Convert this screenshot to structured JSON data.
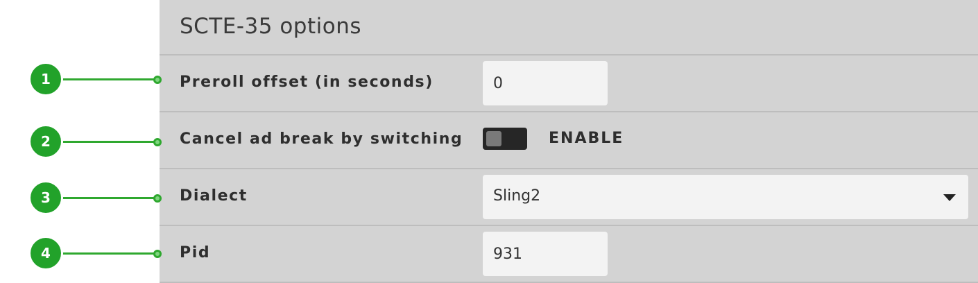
{
  "panel": {
    "title": "SCTE-35 options"
  },
  "rows": {
    "preroll": {
      "label": "Preroll offset (in seconds)",
      "value": "0"
    },
    "cancel_ad_break": {
      "label": "Cancel ad break by switching",
      "toggle_label": "ENABLE",
      "enabled": false
    },
    "dialect": {
      "label": "Dialect",
      "selected": "Sling2"
    },
    "pid": {
      "label": "Pid",
      "value": "931"
    }
  },
  "callouts": [
    "1",
    "2",
    "3",
    "4"
  ],
  "colors": {
    "callout_green": "#22a22a",
    "panel_bg": "#d3d3d3",
    "input_bg": "#f3f3f3",
    "toggle_bg": "#262626"
  },
  "icons": {
    "dropdown": "chevron-down-icon"
  }
}
